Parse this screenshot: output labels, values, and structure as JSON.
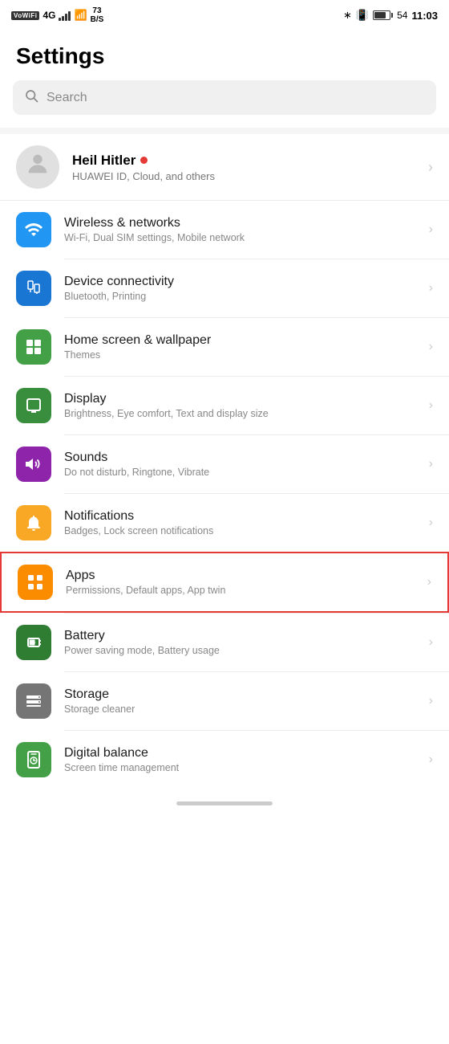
{
  "statusBar": {
    "left": {
      "vowifi": "VoWiFi",
      "network": "4G",
      "signal": "wifi",
      "speed": "73\nB/S"
    },
    "right": {
      "bluetooth": "BT",
      "vibrate": "VIB",
      "battery": "54",
      "time": "11:03"
    }
  },
  "page": {
    "title": "Settings"
  },
  "search": {
    "placeholder": "Search"
  },
  "profile": {
    "name": "Heil Hitler",
    "sub": "HUAWEI ID, Cloud, and others"
  },
  "items": [
    {
      "id": "wireless",
      "icon": "wifi",
      "icon_bg": "#2196F3",
      "title": "Wireless & networks",
      "sub": "Wi-Fi, Dual SIM settings, Mobile network",
      "highlighted": false
    },
    {
      "id": "device-connectivity",
      "icon": "device",
      "icon_bg": "#1976D2",
      "title": "Device connectivity",
      "sub": "Bluetooth, Printing",
      "highlighted": false
    },
    {
      "id": "home-screen",
      "icon": "home",
      "icon_bg": "#4CAF50",
      "title": "Home screen & wallpaper",
      "sub": "Themes",
      "highlighted": false
    },
    {
      "id": "display",
      "icon": "display",
      "icon_bg": "#4CAF50",
      "title": "Display",
      "sub": "Brightness, Eye comfort, Text and display size",
      "highlighted": false
    },
    {
      "id": "sounds",
      "icon": "sound",
      "icon_bg": "#9C27B0",
      "title": "Sounds",
      "sub": "Do not disturb, Ringtone, Vibrate",
      "highlighted": false
    },
    {
      "id": "notifications",
      "icon": "bell",
      "icon_bg": "#FFA000",
      "title": "Notifications",
      "sub": "Badges, Lock screen notifications",
      "highlighted": false
    },
    {
      "id": "apps",
      "icon": "apps",
      "icon_bg": "#FF9800",
      "title": "Apps",
      "sub": "Permissions, Default apps, App twin",
      "highlighted": true
    },
    {
      "id": "battery",
      "icon": "battery",
      "icon_bg": "#4CAF50",
      "title": "Battery",
      "sub": "Power saving mode, Battery usage",
      "highlighted": false
    },
    {
      "id": "storage",
      "icon": "storage",
      "icon_bg": "#757575",
      "title": "Storage",
      "sub": "Storage cleaner",
      "highlighted": false
    },
    {
      "id": "digital-balance",
      "icon": "timer",
      "icon_bg": "#4CAF50",
      "title": "Digital balance",
      "sub": "Screen time management",
      "highlighted": false
    }
  ]
}
